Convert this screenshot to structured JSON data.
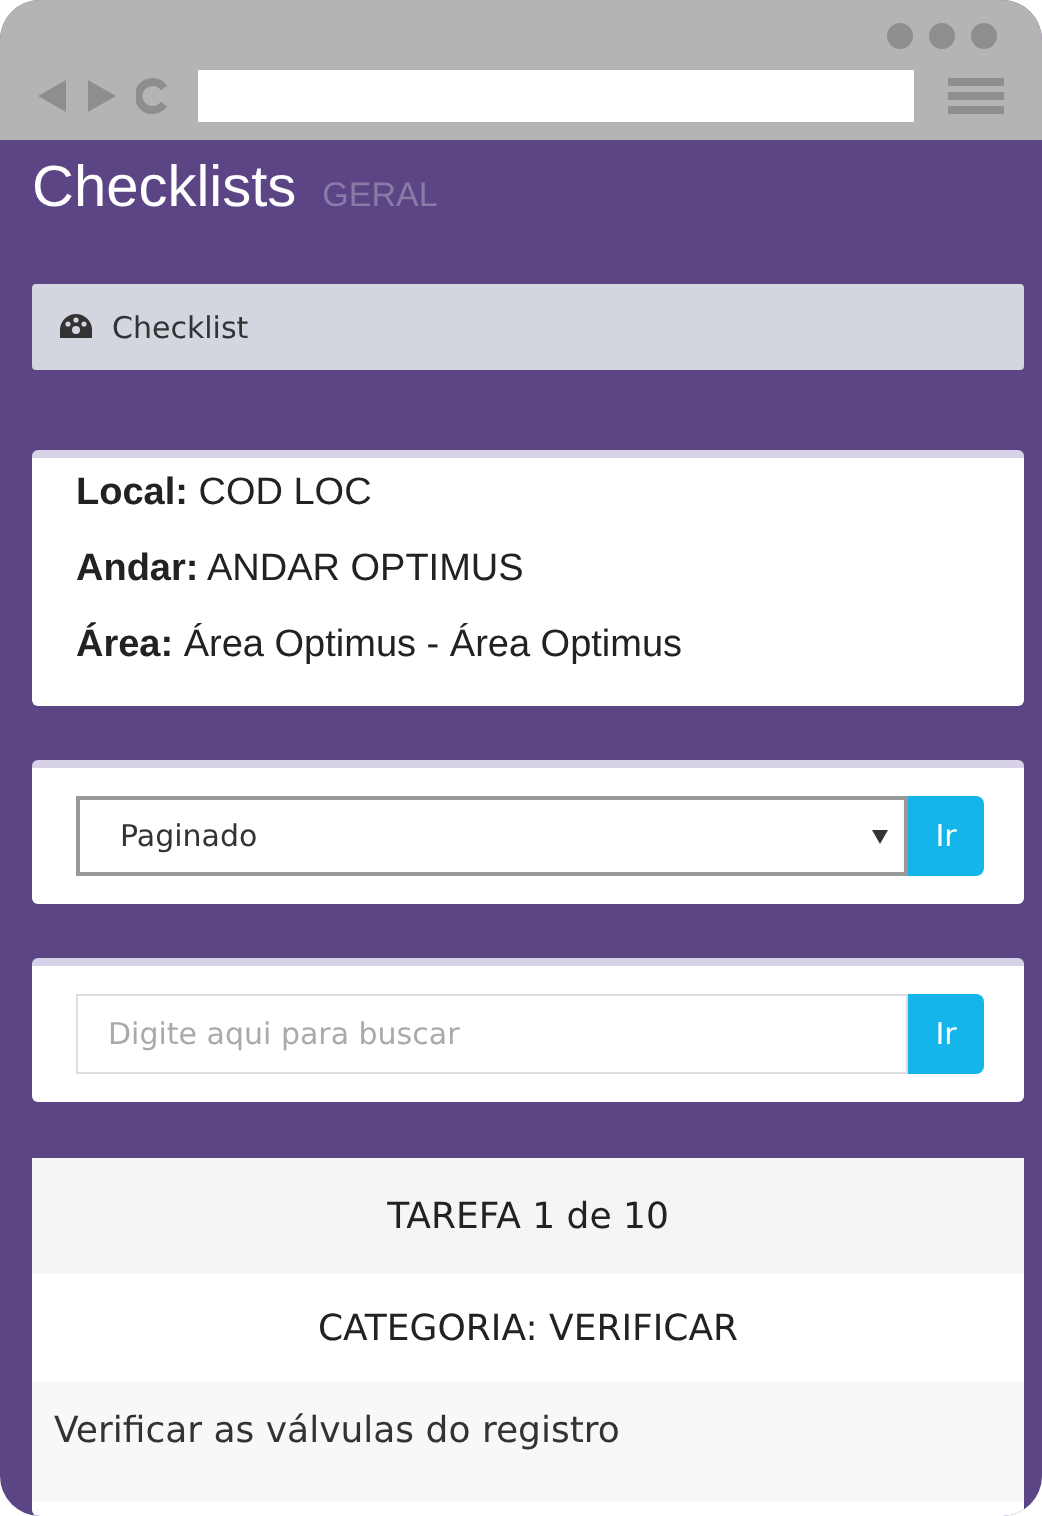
{
  "page": {
    "title": "Checklists",
    "subtitle": "GERAL"
  },
  "breadcrumb": {
    "label": "Checklist"
  },
  "info": [
    {
      "label": "Local:",
      "value": "COD LOC"
    },
    {
      "label": "Andar:",
      "value": "ANDAR OPTIMUS"
    },
    {
      "label": "Área:",
      "value": "Área Optimus - Área Optimus"
    }
  ],
  "mode_select": {
    "value": "Paginado",
    "button": "Ir"
  },
  "search": {
    "placeholder": "Digite aqui para buscar",
    "button": "Ir"
  },
  "task": {
    "counter": "TAREFA 1 de 10",
    "category": "CATEGORIA: VERIFICAR",
    "description": "Verificar as válvulas do registro"
  }
}
